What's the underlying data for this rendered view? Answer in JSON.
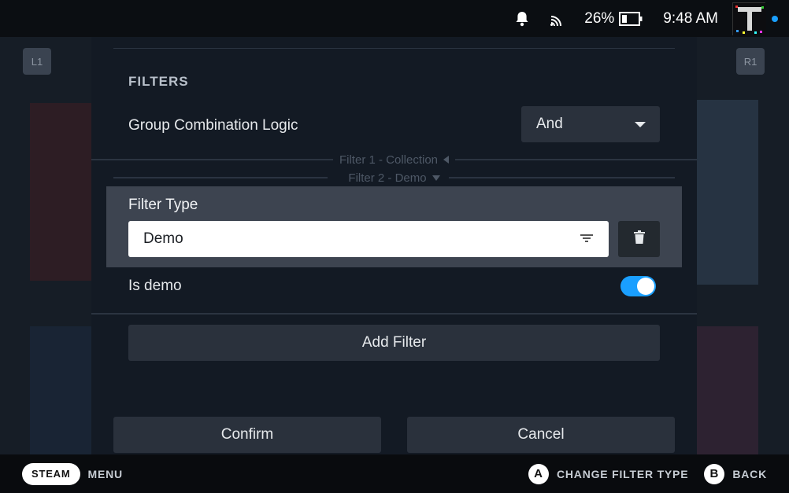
{
  "status_bar": {
    "battery_percent": "26%",
    "time": "9:48 AM",
    "avatar_letter": "T",
    "icons": [
      "bell-icon",
      "cast-icon",
      "battery-icon"
    ]
  },
  "background": {
    "left_nav": "L1",
    "right_nav": "R1"
  },
  "modal": {
    "section_title": "FILTERS",
    "group_logic": {
      "label": "Group Combination Logic",
      "value": "And"
    },
    "filter_headers": [
      {
        "label": "Filter 1 - Collection",
        "state": "collapsed"
      },
      {
        "label": "Filter 2 - Demo",
        "state": "expanded"
      }
    ],
    "filter_type": {
      "label": "Filter Type",
      "value": "Demo"
    },
    "is_demo": {
      "label": "Is demo",
      "checked": true
    },
    "add_filter_label": "Add Filter",
    "confirm_label": "Confirm",
    "cancel_label": "Cancel"
  },
  "bottom_bar": {
    "steam_label": "STEAM",
    "menu_label": "MENU",
    "hint_a_key": "A",
    "hint_a_label": "CHANGE FILTER TYPE",
    "hint_b_key": "B",
    "hint_b_label": "BACK"
  },
  "colors": {
    "accent": "#1a9fff",
    "modal_bg": "#131a24",
    "button_bg": "#2a313c",
    "focused_row_bg": "#3d4450"
  }
}
